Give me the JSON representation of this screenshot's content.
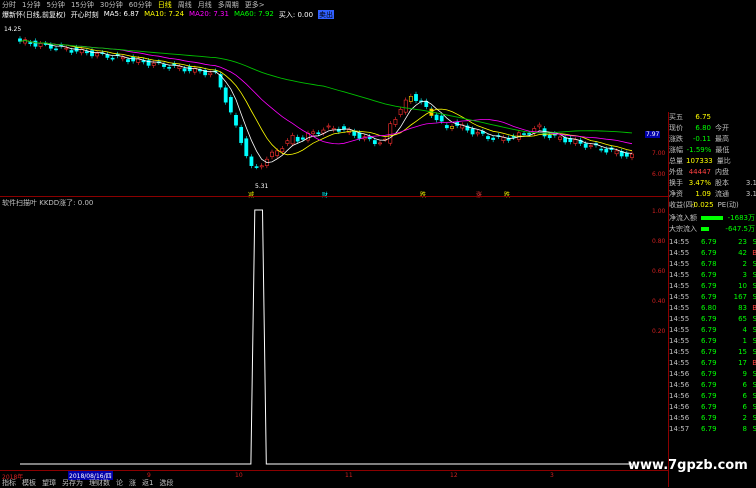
{
  "topbar": {
    "tabs": [
      "分时",
      "1分钟",
      "5分钟",
      "15分钟",
      "30分钟",
      "60分钟",
      "日线",
      "周线",
      "月线",
      "多周期",
      "更多>"
    ],
    "active": "日线"
  },
  "legend1": {
    "title": "爆新怀(日线,前复权)",
    "indicator": "开心时刻",
    "ma5": "MA5: 6.87",
    "ma10": "MA10: 7.24",
    "ma20": "MA20: 7.31",
    "ma60": "MA60: 7.92",
    "buy": "买入: 0.00",
    "sell": "卖出"
  },
  "price_axis": [
    "7.00",
    "6.00"
  ],
  "price_labels": {
    "high": "14.25",
    "low": "5.31",
    "mark": "7.97"
  },
  "markers": [
    "减",
    "财",
    "跌",
    "涨",
    "跌"
  ],
  "legend2": "软件扫描叶 KKDD涨了: 0.00",
  "ind_axis": [
    "1.00",
    "0.80",
    "0.60",
    "0.40",
    "0.20"
  ],
  "quote": {
    "rows": [
      [
        "买五",
        "6.75",
        "",
        ""
      ],
      [
        "现价",
        "6.80",
        "今开",
        ""
      ],
      [
        "涨跌",
        "-0.11",
        "最高",
        ""
      ],
      [
        "涨幅",
        "-1.59%",
        "最低",
        ""
      ],
      [
        "总量",
        "107333",
        "量比",
        ""
      ],
      [
        "外盘",
        "44447",
        "内盘",
        ""
      ],
      [
        "换手",
        "3.47%",
        "股本",
        "3.1"
      ],
      [
        "净资",
        "1.09",
        "流通",
        "3.1"
      ],
      [
        "收益(四)",
        "-0.025",
        "PE(动)",
        ""
      ]
    ],
    "flow": [
      [
        "净流入额",
        "-1683万"
      ],
      [
        "大宗流入",
        "-647.5万"
      ]
    ]
  },
  "ticks": [
    [
      "14:55",
      "6.79",
      "23",
      "S"
    ],
    [
      "14:55",
      "6.79",
      "42",
      "B"
    ],
    [
      "14:55",
      "6.78",
      "2",
      "S"
    ],
    [
      "14:55",
      "6.79",
      "3",
      "S"
    ],
    [
      "14:55",
      "6.79",
      "10",
      "S"
    ],
    [
      "14:55",
      "6.79",
      "167",
      "S"
    ],
    [
      "14:55",
      "6.80",
      "83",
      "B"
    ],
    [
      "14:55",
      "6.79",
      "65",
      "S"
    ],
    [
      "14:55",
      "6.79",
      "4",
      "S"
    ],
    [
      "14:55",
      "6.79",
      "1",
      "S"
    ],
    [
      "14:55",
      "6.79",
      "15",
      "S"
    ],
    [
      "14:55",
      "6.79",
      "17",
      "B"
    ],
    [
      "14:56",
      "6.79",
      "9",
      "S"
    ],
    [
      "14:56",
      "6.79",
      "6",
      "S"
    ],
    [
      "14:56",
      "6.79",
      "6",
      "S"
    ],
    [
      "14:56",
      "6.79",
      "6",
      "S"
    ],
    [
      "14:56",
      "6.79",
      "2",
      "S"
    ],
    [
      "14:57",
      "6.79",
      "8",
      "S"
    ]
  ],
  "xaxis": {
    "left": "2018年",
    "selected": "2018/08/16/四",
    "months": [
      "9",
      "10",
      "11",
      "12",
      "3"
    ]
  },
  "bottombar": [
    "指标",
    "模板",
    "望璋",
    "另存为",
    "理财数",
    "论",
    "涨",
    "返1",
    "选段"
  ],
  "watermark": "www.7gpzb.com",
  "chart_data": {
    "type": "line",
    "series": [
      {
        "name": "KKDD涨了",
        "values": [
          0,
          0,
          0,
          0,
          0,
          0,
          0,
          0,
          0,
          0,
          0,
          0,
          0,
          0,
          0,
          0,
          0,
          0,
          0,
          0,
          0,
          0,
          0,
          0,
          0,
          0,
          0,
          0,
          0,
          0,
          0,
          0,
          0,
          0,
          0,
          0,
          0,
          0,
          0,
          0,
          0,
          0,
          0,
          0,
          0,
          0,
          0,
          0,
          0,
          0,
          0,
          0,
          0,
          0,
          0,
          0,
          0,
          0,
          0,
          0,
          0,
          1,
          1,
          1,
          0,
          0,
          0,
          0,
          0,
          0,
          0,
          0,
          0,
          0,
          0,
          0,
          0,
          0,
          0,
          0,
          0,
          0,
          0,
          0,
          0,
          0,
          0,
          0,
          0,
          0,
          0,
          0,
          0,
          0,
          0,
          0,
          0,
          0,
          0,
          0,
          0,
          0,
          0,
          0,
          0,
          0,
          0,
          0,
          0,
          0,
          0,
          0,
          0,
          0,
          0,
          0,
          0,
          0,
          0,
          0,
          0,
          0,
          0,
          0,
          0,
          0,
          0,
          0,
          0,
          0,
          0,
          0,
          0,
          0,
          0,
          0,
          0,
          0,
          0,
          0,
          0,
          0,
          0,
          0,
          0,
          0,
          0,
          0,
          0,
          0,
          0,
          0,
          0,
          0,
          0,
          0,
          0,
          0,
          0,
          0
        ]
      }
    ],
    "ylim": [
      0,
      1
    ]
  }
}
